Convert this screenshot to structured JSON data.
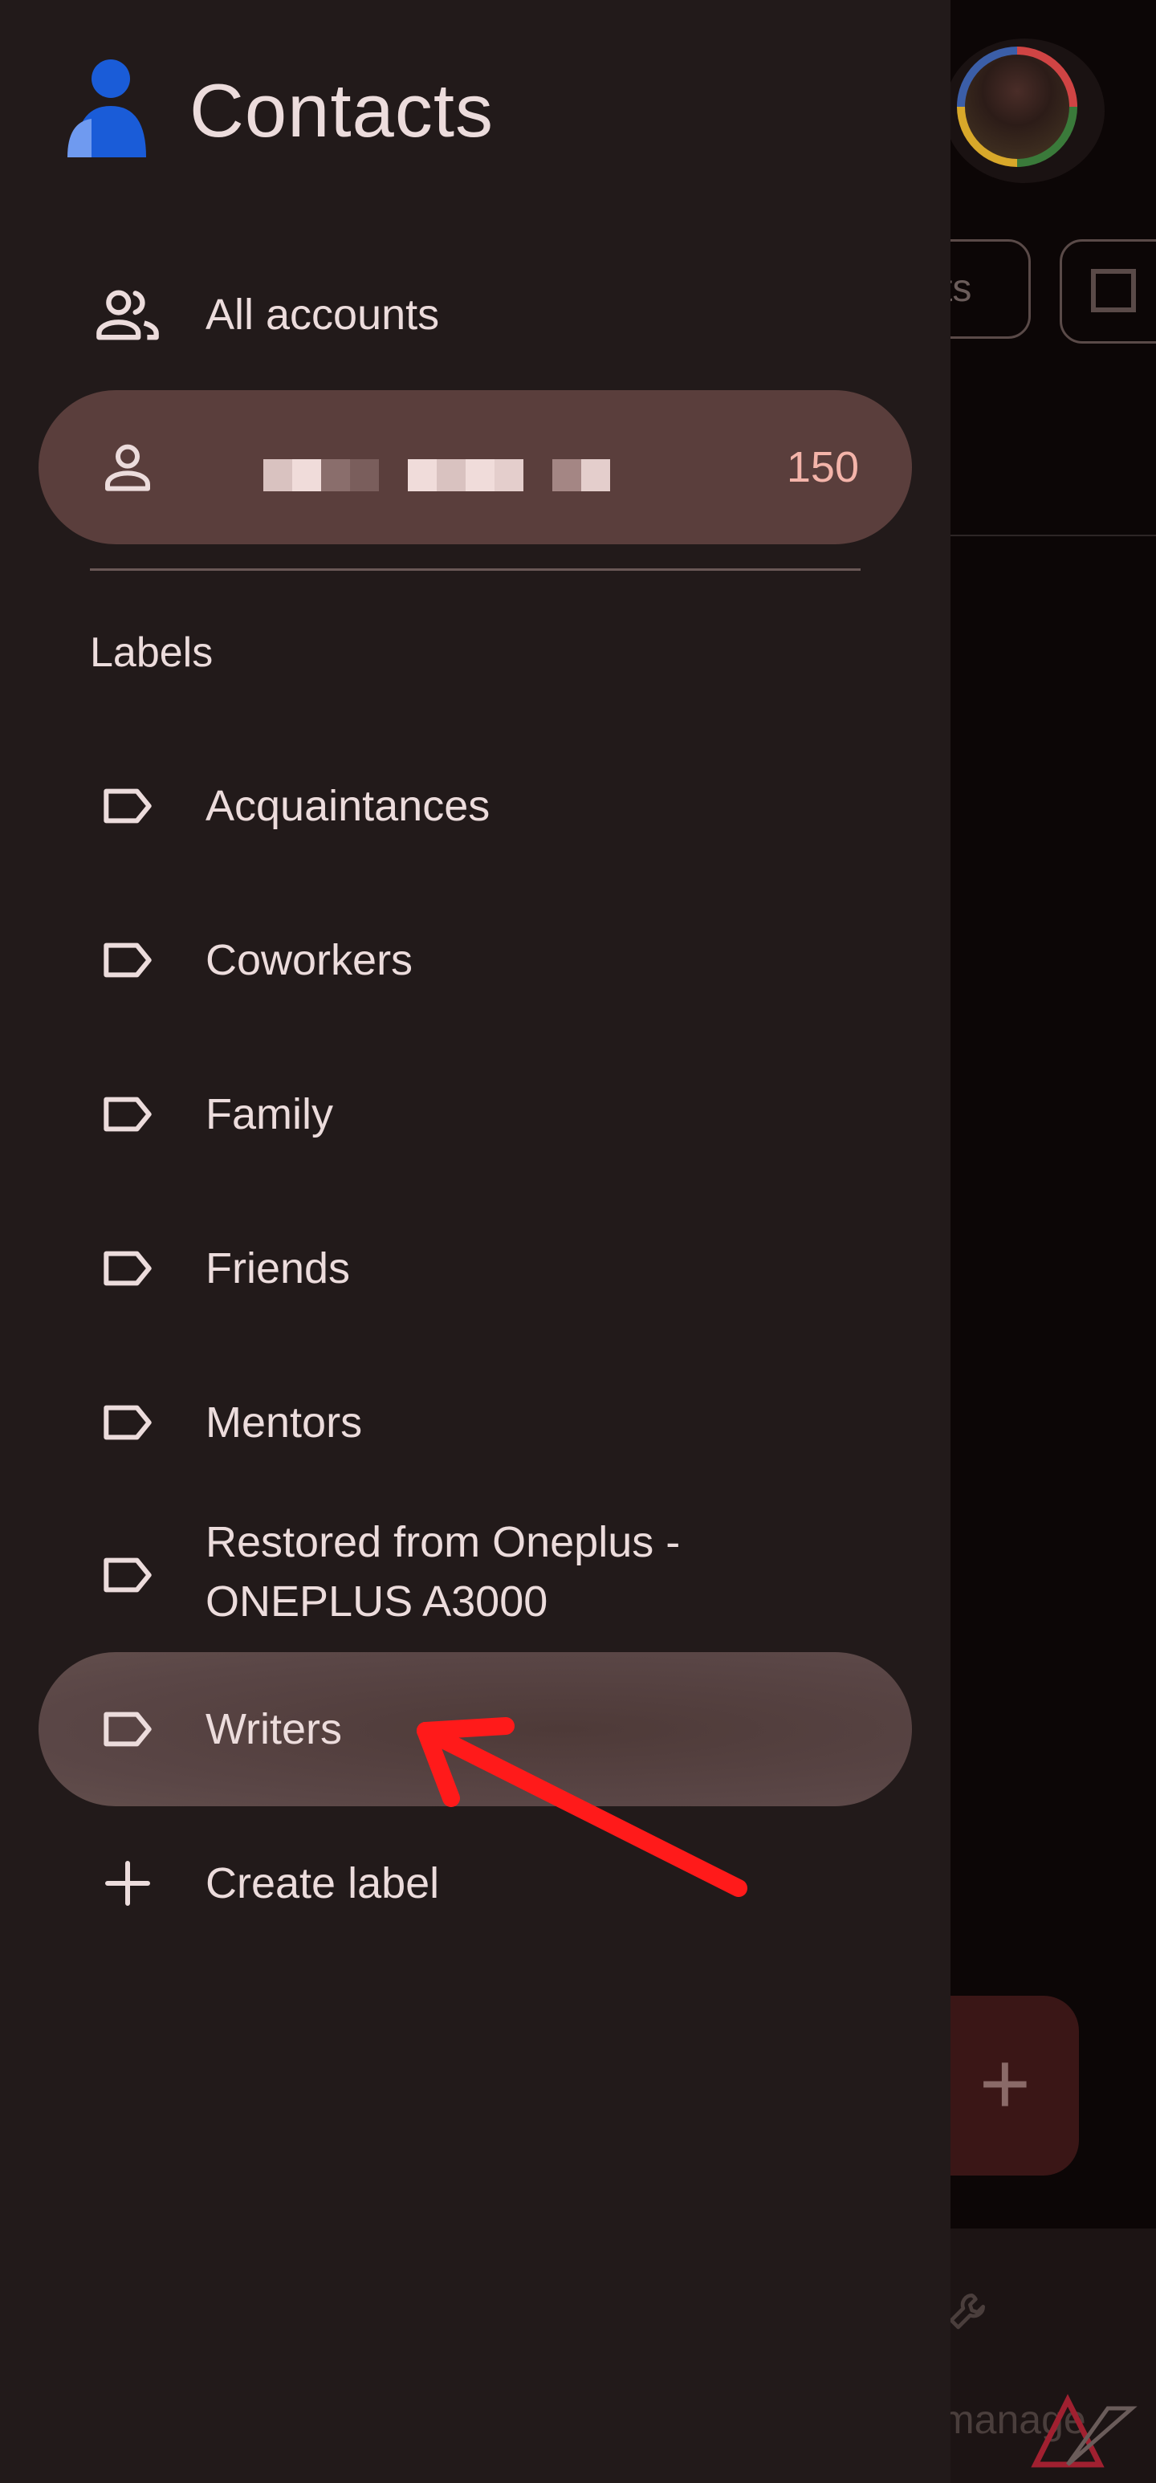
{
  "app": {
    "title": "Contacts"
  },
  "drawer": {
    "all_accounts_label": "All accounts",
    "account": {
      "contact_count": "150"
    },
    "labels_heading": "Labels",
    "labels": [
      {
        "label": "Acquaintances"
      },
      {
        "label": "Coworkers"
      },
      {
        "label": "Family"
      },
      {
        "label": "Friends"
      },
      {
        "label": "Mentors"
      },
      {
        "label_line1": "Restored from Oneplus -",
        "label_line2": "ONEPLUS A3000"
      },
      {
        "label": "Writers",
        "selected": true
      }
    ],
    "create_label": "Create label"
  },
  "background": {
    "chip_partial_text": "ts",
    "bottom_nav_partial_text": "manage"
  },
  "colors": {
    "drawer_bg": "#221a1a",
    "selected_row_bg": "#5a3e3c",
    "count_accent": "#f4b4aa",
    "annotation_arrow": "#ff1a1a",
    "logo_blue": "#1a5cd8"
  }
}
